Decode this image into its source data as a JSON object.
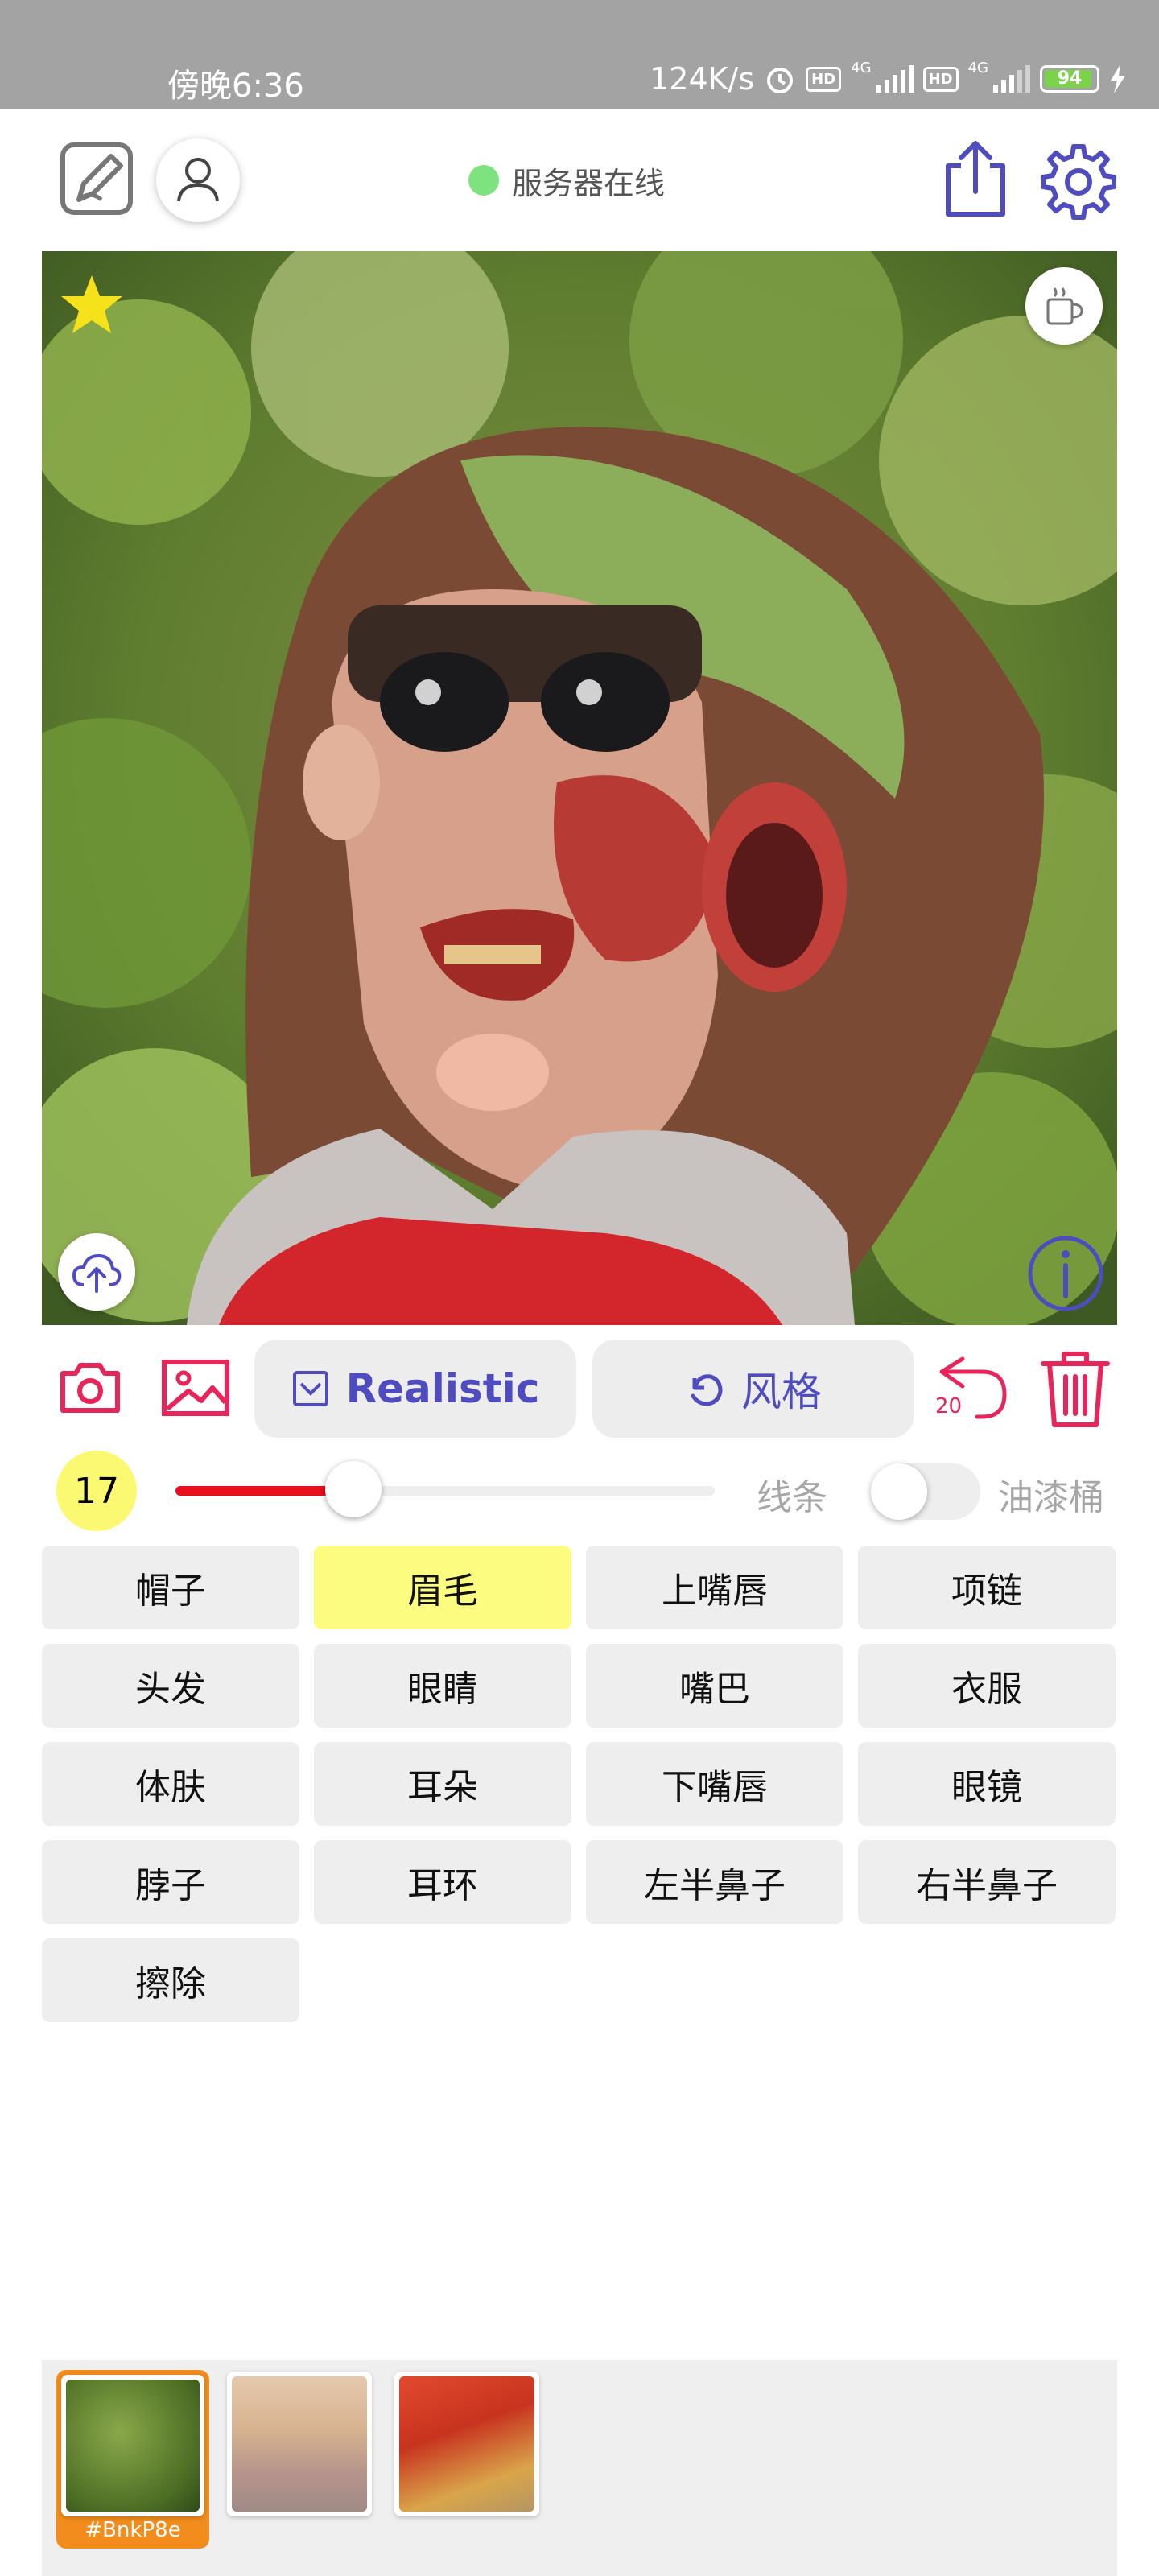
{
  "status_bar": {
    "time": "傍晚6:36",
    "network_speed": "124K/s",
    "net_type_1": "4G",
    "net_type_2": "4G",
    "hd_1": "HD",
    "hd_2": "HD",
    "battery": "94"
  },
  "header": {
    "server_status": "服务器在线",
    "server_status_color": "#7ee27e",
    "icons": [
      "sketch-icon",
      "user-icon",
      "share-icon",
      "gear-icon"
    ]
  },
  "canvas": {
    "icons": [
      "star-icon",
      "coffee-icon",
      "cloud-upload-icon",
      "info-icon"
    ]
  },
  "toolbar": {
    "mode_label": "Realistic",
    "style_label": "风格",
    "undo_count": "20",
    "accent_color": "#e8255b",
    "primary_color": "#4e4cbf"
  },
  "brush": {
    "size": "17",
    "slider_fraction": 0.33,
    "line_label": "线条",
    "bucket_label": "油漆桶",
    "bucket_enabled": false
  },
  "parts": [
    {
      "label": "帽子",
      "selected": false
    },
    {
      "label": "眉毛",
      "selected": true
    },
    {
      "label": "上嘴唇",
      "selected": false
    },
    {
      "label": "项链",
      "selected": false
    },
    {
      "label": "头发",
      "selected": false
    },
    {
      "label": "眼睛",
      "selected": false
    },
    {
      "label": "嘴巴",
      "selected": false
    },
    {
      "label": "衣服",
      "selected": false
    },
    {
      "label": "体肤",
      "selected": false
    },
    {
      "label": "耳朵",
      "selected": false
    },
    {
      "label": "下嘴唇",
      "selected": false
    },
    {
      "label": "眼镜",
      "selected": false
    },
    {
      "label": "脖子",
      "selected": false
    },
    {
      "label": "耳环",
      "selected": false
    },
    {
      "label": "左半鼻子",
      "selected": false
    },
    {
      "label": "右半鼻子",
      "selected": false
    },
    {
      "label": "擦除",
      "selected": false
    }
  ],
  "thumbnails": {
    "selected_label": "#BnkP8e"
  }
}
